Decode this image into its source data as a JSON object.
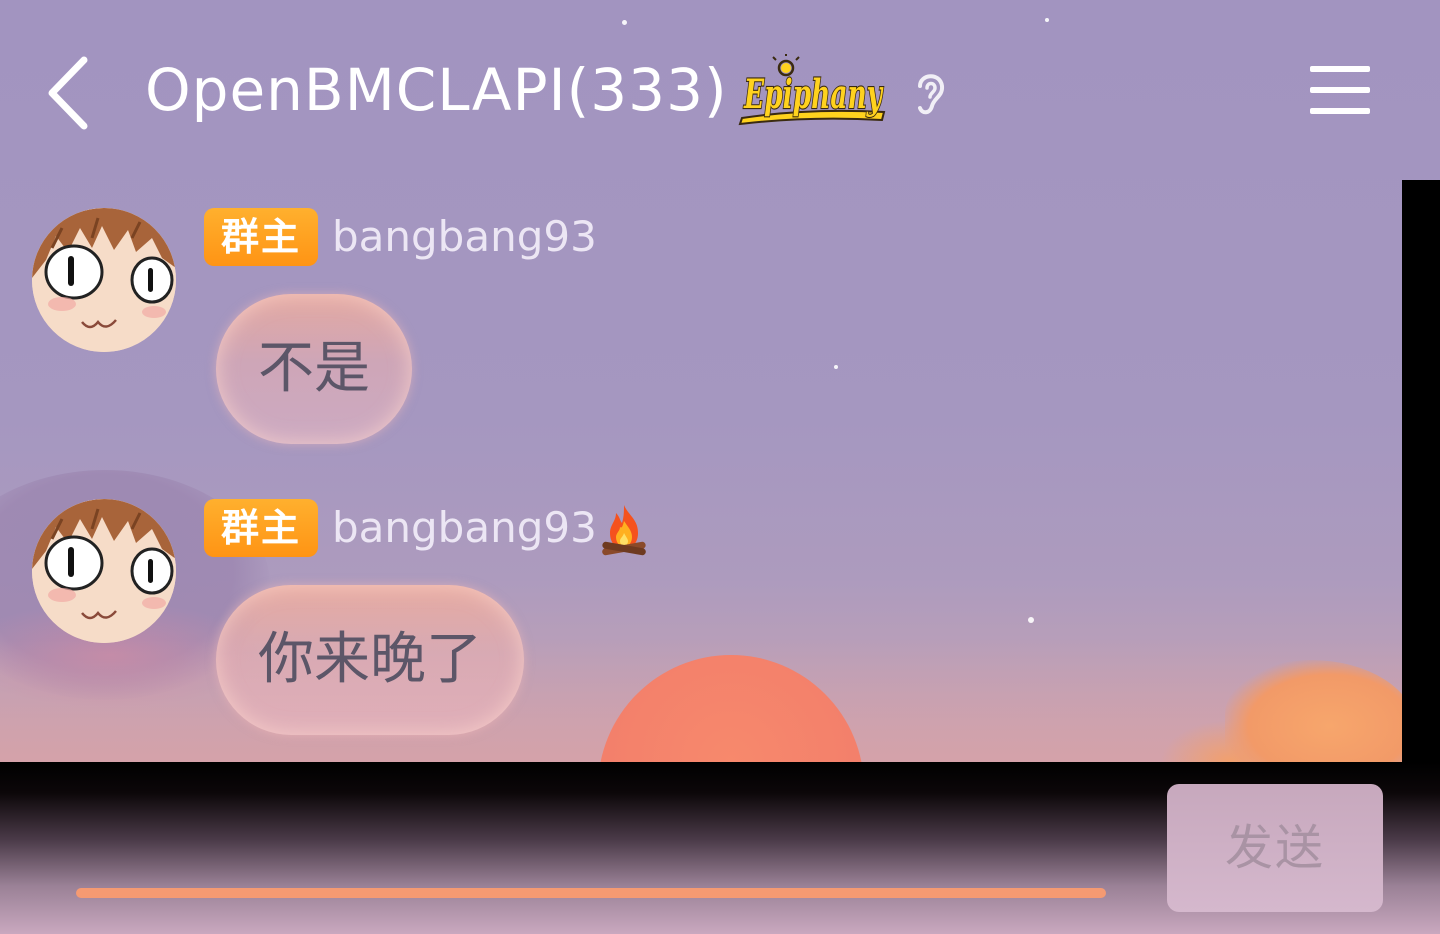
{
  "header": {
    "title": "OpenBMCLAPI(333)",
    "back_icon": "chevron-left-icon",
    "menu_icon": "hamburger-menu-icon",
    "brand_badge_text": "Epiphany",
    "ear_icon": "ear-icon"
  },
  "messages": [
    {
      "role_badge": "群主",
      "sender": "bangbang93",
      "text": "不是",
      "has_fire_badge": false
    },
    {
      "role_badge": "群主",
      "sender": "bangbang93",
      "text": "你来晚了",
      "has_fire_badge": true,
      "fire_icon": "campfire-icon"
    }
  ],
  "composer": {
    "send_label": "发送",
    "input_value": ""
  },
  "colors": {
    "badge": "#ff9a1e",
    "bubble": "#f2b3ae",
    "send_button": "#cdb1c6",
    "input_underline": "#f59a72"
  }
}
